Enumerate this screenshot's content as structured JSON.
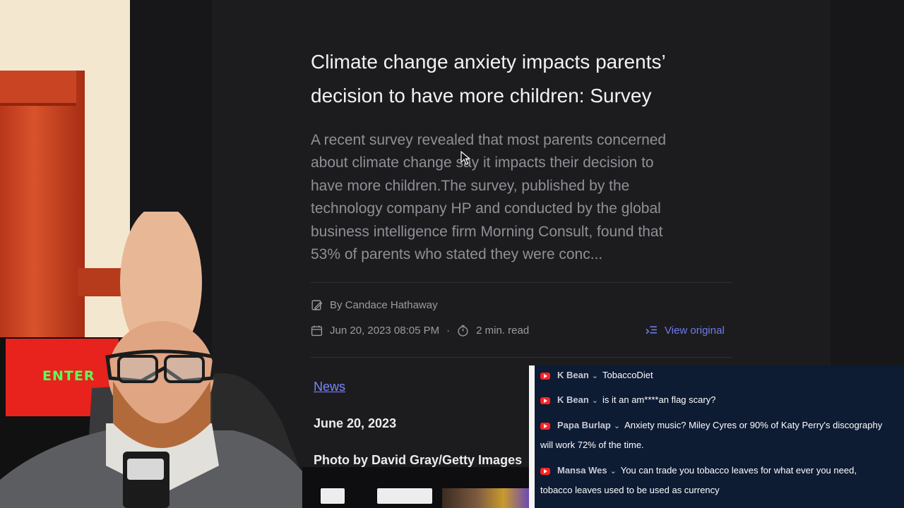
{
  "article": {
    "title_line1": "Climate change anxiety impacts parents’",
    "title_line2": "decision to have more children: Survey",
    "summary_lines": [
      "A recent survey revealed that most parents concerned",
      "about climate change say it impacts their decision to",
      "have more children.The survey, published by the",
      "technology company HP and conducted by the global",
      "business intelligence firm Morning Consult, found that",
      "53% of parents who stated they were conc..."
    ],
    "byline": "By Candace Hathaway",
    "datetime": "Jun 20, 2023 08:05 PM",
    "separator": "·",
    "read_time": "2 min. read",
    "view_original": "View original",
    "tag": "News",
    "date_line": "June 20, 2023",
    "photo_credit": "Photo by David Gray/Getty Images"
  },
  "overlay": {
    "logo_text": "ENTER"
  },
  "chat": {
    "messages": [
      {
        "name": "K Bean",
        "text": "TobaccoDiet"
      },
      {
        "name": "K Bean",
        "text": "is it an am****an flag scary?"
      },
      {
        "name": "Papa Burlap",
        "text": "Anxiety music? Miley Cyres or 90% of Katy Perry's discography",
        "text2": "will work 72% of the time."
      },
      {
        "name": "Mansa Wes",
        "text": "You can trade you tobacco leaves for what ever you need,",
        "text2": "tobacco leaves used to be used as currency"
      }
    ]
  },
  "icons": {
    "edit": "edit-icon",
    "calendar": "calendar-icon",
    "timer": "timer-icon",
    "view_original": "view-original-icon",
    "youtube": "youtube-icon"
  },
  "colors": {
    "link": "#7a86ff",
    "chat_bg": "#0d1b33",
    "youtube_red": "#ff2323"
  }
}
